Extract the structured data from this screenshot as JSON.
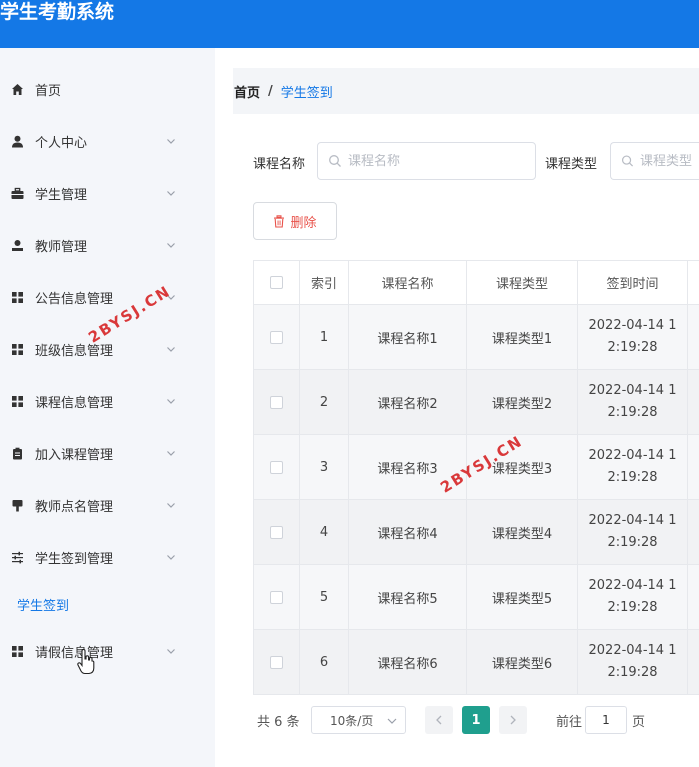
{
  "app": {
    "title": "学生考勤系统"
  },
  "sidebar": {
    "items": [
      {
        "label": "首页",
        "icon": "home-icon",
        "expandable": false
      },
      {
        "label": "个人中心",
        "icon": "user-icon",
        "expandable": true
      },
      {
        "label": "学生管理",
        "icon": "briefcase-icon",
        "expandable": true
      },
      {
        "label": "教师管理",
        "icon": "person-icon",
        "expandable": true
      },
      {
        "label": "公告信息管理",
        "icon": "grid-icon",
        "expandable": true
      },
      {
        "label": "班级信息管理",
        "icon": "grid-icon",
        "expandable": true
      },
      {
        "label": "课程信息管理",
        "icon": "grid-icon",
        "expandable": true
      },
      {
        "label": "加入课程管理",
        "icon": "clipboard-icon",
        "expandable": true
      },
      {
        "label": "教师点名管理",
        "icon": "stamp-icon",
        "expandable": true
      },
      {
        "label": "学生签到管理",
        "icon": "sliders-icon",
        "expandable": true,
        "expanded": true
      },
      {
        "label": "请假信息管理",
        "icon": "grid-icon",
        "expandable": true
      }
    ],
    "submenu": {
      "label": "学生签到"
    }
  },
  "breadcrumb": {
    "home": "首页",
    "separator": "/",
    "current": "学生签到"
  },
  "filters": {
    "course_name": {
      "label": "课程名称",
      "placeholder": "课程名称"
    },
    "course_type": {
      "label": "课程类型",
      "placeholder": "课程类型"
    }
  },
  "actions": {
    "delete_label": "删除"
  },
  "table": {
    "columns": [
      "索引",
      "课程名称",
      "课程类型",
      "签到时间"
    ],
    "rows": [
      {
        "index": "1",
        "course_name": "课程名称1",
        "course_type": "课程类型1",
        "time_line1": "2022-04-14 1",
        "time_line2": "2:19:28"
      },
      {
        "index": "2",
        "course_name": "课程名称2",
        "course_type": "课程类型2",
        "time_line1": "2022-04-14 1",
        "time_line2": "2:19:28"
      },
      {
        "index": "3",
        "course_name": "课程名称3",
        "course_type": "课程类型3",
        "time_line1": "2022-04-14 1",
        "time_line2": "2:19:28"
      },
      {
        "index": "4",
        "course_name": "课程名称4",
        "course_type": "课程类型4",
        "time_line1": "2022-04-14 1",
        "time_line2": "2:19:28"
      },
      {
        "index": "5",
        "course_name": "课程名称5",
        "course_type": "课程类型5",
        "time_line1": "2022-04-14 1",
        "time_line2": "2:19:28"
      },
      {
        "index": "6",
        "course_name": "课程名称6",
        "course_type": "课程类型6",
        "time_line1": "2022-04-14 1",
        "time_line2": "2:19:28"
      }
    ]
  },
  "pagination": {
    "total_text": "共 6 条",
    "page_size": "10条/页",
    "current_page": "1",
    "goto_label": "前往",
    "goto_value": "1",
    "page_unit": "页"
  },
  "watermark": {
    "text": "2BYSJ.CN"
  },
  "colors": {
    "header": "#1478e6",
    "accent": "#1478e6",
    "active_page": "#1f9f8e",
    "danger": "#e8524a",
    "sidebar_bg": "#f4f6fa"
  }
}
